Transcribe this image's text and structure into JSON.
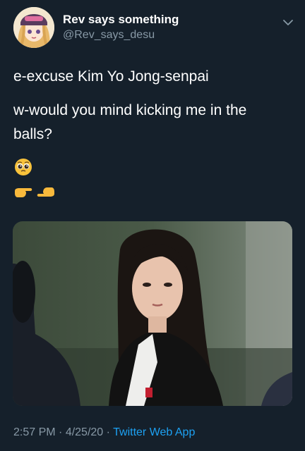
{
  "tweet": {
    "author": {
      "display_name": "Rev says something",
      "handle": "@Rev_says_desu",
      "avatar_icon": "anime-girl-avatar"
    },
    "lines": [
      "e-excuse Kim Yo Jong-senpai",
      "w-would you mind kicking me in the",
      "balls?"
    ],
    "emojis": {
      "pleading": "pleading-face-emoji",
      "fingers": "index-fingers-touching-emoji"
    },
    "media": {
      "description_icon": "woman-portrait-photo"
    },
    "footer": {
      "time": "2:57 PM",
      "sep1": " · ",
      "date": "4/25/20",
      "sep2": " · ",
      "app": "Twitter Web App"
    }
  },
  "colors": {
    "background": "#15202b",
    "secondary_text": "#8899a6",
    "link": "#1da1f2"
  }
}
